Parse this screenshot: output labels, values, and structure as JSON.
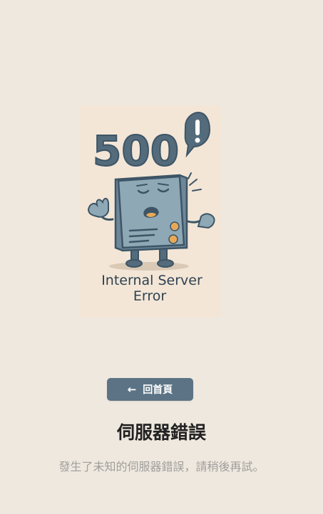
{
  "illustration": {
    "code_text": "500",
    "caption_line1": "Internal Server",
    "caption_line2": "Error",
    "colors": {
      "background": "#f3e6d7",
      "server_body": "#8fa8b6",
      "outline": "#3d5566",
      "accent": "#e8a857"
    }
  },
  "home_button": {
    "icon": "arrow-left-icon",
    "label": "回首頁",
    "color": "#5b7385"
  },
  "error": {
    "title": "伺服器錯誤",
    "description": "發生了未知的伺服器錯誤，請稍後再試。"
  },
  "colors": {
    "page_background": "#efe8df",
    "title": "#222222",
    "description": "#a09e9b"
  }
}
